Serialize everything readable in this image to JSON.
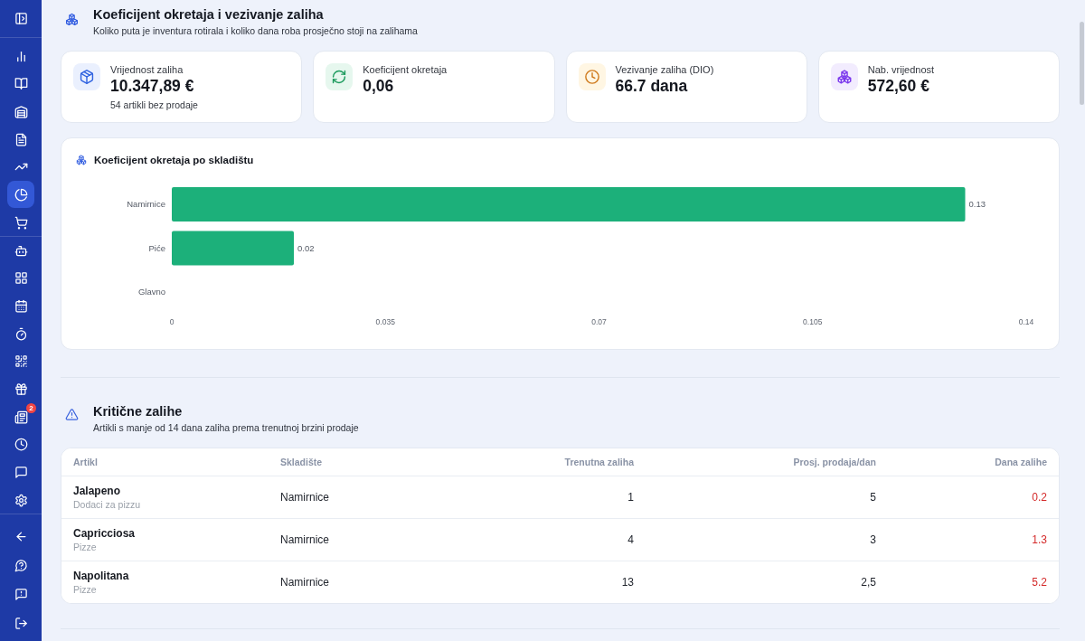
{
  "sidebar": {
    "groups": [
      {
        "items": [
          {
            "selected": false
          }
        ]
      },
      {
        "items": [
          {
            "selected": false
          },
          {
            "selected": false
          },
          {
            "selected": false
          },
          {
            "selected": false
          },
          {
            "selected": false
          },
          {
            "selected": true
          },
          {
            "selected": false
          }
        ]
      },
      {
        "items": [
          {
            "selected": false
          },
          {
            "selected": false
          },
          {
            "selected": false
          },
          {
            "selected": false
          },
          {
            "selected": false
          },
          {
            "selected": false
          },
          {
            "selected": false,
            "badge": "2"
          },
          {
            "selected": false
          },
          {
            "selected": false
          },
          {
            "selected": false
          }
        ]
      },
      {
        "items": [
          {
            "selected": false
          },
          {
            "selected": false
          },
          {
            "selected": false
          },
          {
            "selected": false
          }
        ]
      }
    ]
  },
  "turnover_section": {
    "title": "Koeficijent okretaja i vezivanje zaliha",
    "subtitle": "Koliko puta je inventura rotirala i koliko dana roba prosječno stoji na zalihama",
    "stats": [
      {
        "label": "Vrijednost zaliha",
        "value": "10.347,89 €",
        "note": "54 artikli bez prodaje"
      },
      {
        "label": "Koeficijent okretaja",
        "value": "0,06"
      },
      {
        "label": "Vezivanje zaliha (DIO)",
        "value": "66.7 dana"
      },
      {
        "label": "Nab. vrijednost",
        "value": "572,60 €"
      }
    ],
    "chart_card": {
      "title": "Koeficijent okretaja po skladištu",
      "chart_data": {
        "type": "bar",
        "orientation": "horizontal",
        "categories": [
          "Namirnice",
          "Piće",
          "Glavno"
        ],
        "values": [
          0.13,
          0.02,
          0
        ],
        "xlim": [
          0,
          0.14
        ],
        "xticks": [
          0,
          0.035,
          0.07,
          0.105,
          0.14
        ],
        "value_labels": [
          "0.13",
          "0.02",
          null
        ]
      }
    }
  },
  "critical_section": {
    "title": "Kritične zalihe",
    "subtitle": "Artikli s manje od 14 dana zaliha prema trenutnoj brzini prodaje",
    "table": {
      "columns": [
        "Artikl",
        "Skladište",
        "Trenutna zaliha",
        "Prosj. prodaja/dan",
        "Dana zalihe"
      ],
      "rows": [
        {
          "article": "Jalapeno",
          "category": "Dodaci za pizzu",
          "warehouse": "Namirnice",
          "current_stock": "1",
          "avg_daily_sales": "5",
          "days_of_stock": "0.2"
        },
        {
          "article": "Capricciosa",
          "category": "Pizze",
          "warehouse": "Namirnice",
          "current_stock": "4",
          "avg_daily_sales": "3",
          "days_of_stock": "1.3"
        },
        {
          "article": "Napolitana",
          "category": "Pizze",
          "warehouse": "Namirnice",
          "current_stock": "13",
          "avg_daily_sales": "2,5",
          "days_of_stock": "5.2"
        }
      ]
    }
  }
}
